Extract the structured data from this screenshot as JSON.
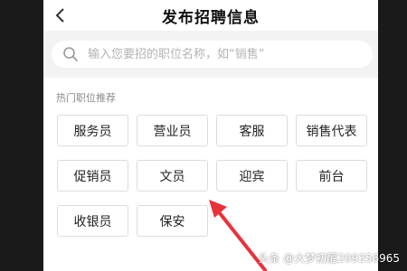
{
  "header": {
    "title": "发布招聘信息"
  },
  "search": {
    "placeholder": "输入您要招的职位名称，如“销售”"
  },
  "hot_jobs": {
    "label": "热门职位推荐",
    "items": [
      "服务员",
      "营业员",
      "客服",
      "销售代表",
      "促销员",
      "文员",
      "迎宾",
      "前台",
      "收银员",
      "保安"
    ]
  },
  "watermark": "头条 @大梦初醒209356965",
  "colors": {
    "arrow": "#e8323c",
    "background": "#1a1a1a",
    "search_bg": "#f3f3f3"
  }
}
